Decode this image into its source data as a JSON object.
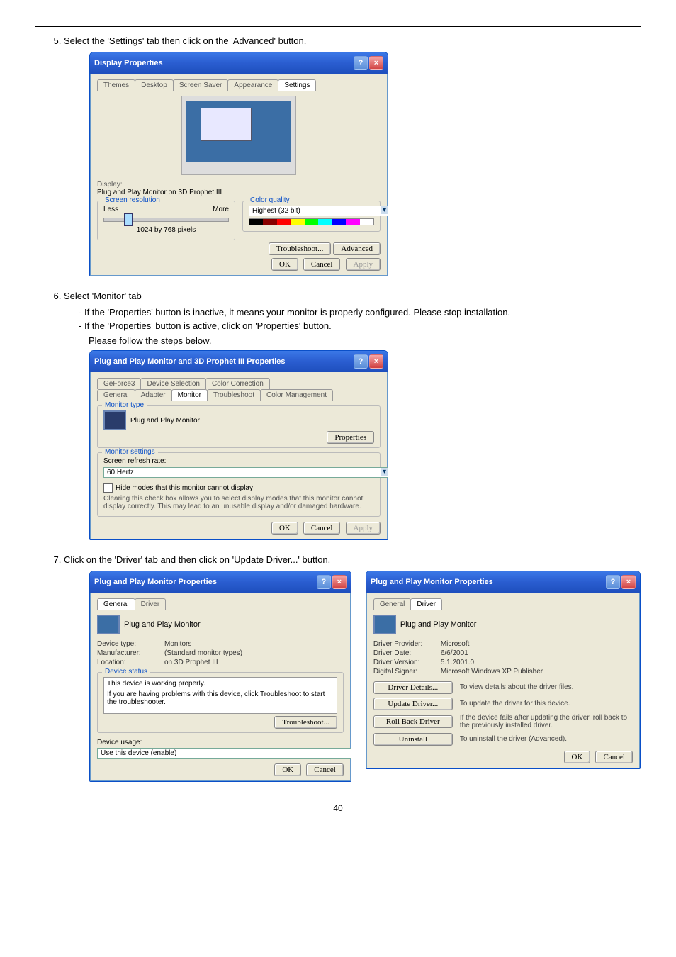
{
  "page_number": "40",
  "steps": {
    "s5": "Select the 'Settings' tab then click on the 'Advanced' button.",
    "s6": "Select 'Monitor' tab",
    "s6_a": "If the 'Properties' button is inactive, it means your monitor is properly configured. Please stop installation.",
    "s6_b": "If the 'Properties' button is active, click on 'Properties' button.",
    "s6_follow": "Please follow the steps below.",
    "s7": "Click on the 'Driver' tab and then click on 'Update Driver...' button."
  },
  "win1": {
    "title": "Display Properties",
    "tabs": [
      "Themes",
      "Desktop",
      "Screen Saver",
      "Appearance",
      "Settings"
    ],
    "display_label": "Display:",
    "display_value": "Plug and Play Monitor on 3D Prophet III",
    "screen_res_title": "Screen resolution",
    "less": "Less",
    "more": "More",
    "res_value": "1024 by 768 pixels",
    "color_title": "Color quality",
    "color_value": "Highest (32 bit)",
    "troubleshoot": "Troubleshoot...",
    "advanced": "Advanced",
    "ok": "OK",
    "cancel": "Cancel",
    "apply": "Apply"
  },
  "win2": {
    "title": "Plug and Play Monitor and 3D Prophet III Properties",
    "top_tabs": [
      "GeForce3",
      "Device Selection",
      "Color Correction"
    ],
    "bot_tabs": [
      "General",
      "Adapter",
      "Monitor",
      "Troubleshoot",
      "Color Management"
    ],
    "montype_title": "Monitor type",
    "montype_name": "Plug and Play Monitor",
    "properties": "Properties",
    "monset_title": "Monitor settings",
    "refresh_label": "Screen refresh rate:",
    "refresh_value": "60 Hertz",
    "hide_checkbox": "Hide modes that this monitor cannot display",
    "hide_explain": "Clearing this check box allows you to select display modes that this monitor cannot display correctly. This may lead to an unusable display and/or damaged hardware.",
    "ok": "OK",
    "cancel": "Cancel",
    "apply": "Apply"
  },
  "win3": {
    "title": "Plug and Play Monitor Properties",
    "tabs": [
      "General",
      "Driver"
    ],
    "name": "Plug and Play Monitor",
    "devtype_k": "Device type:",
    "devtype_v": "Monitors",
    "mfg_k": "Manufacturer:",
    "mfg_v": "(Standard monitor types)",
    "loc_k": "Location:",
    "loc_v": "on 3D Prophet III",
    "status_title": "Device status",
    "status_text": "This device is working properly.",
    "status_hint": "If you are having problems with this device, click Troubleshoot to start the troubleshooter.",
    "troubleshoot": "Troubleshoot...",
    "usage_label": "Device usage:",
    "usage_value": "Use this device (enable)",
    "ok": "OK",
    "cancel": "Cancel"
  },
  "win4": {
    "title": "Plug and Play Monitor Properties",
    "tabs": [
      "General",
      "Driver"
    ],
    "name": "Plug and Play Monitor",
    "prov_k": "Driver Provider:",
    "prov_v": "Microsoft",
    "date_k": "Driver Date:",
    "date_v": "6/6/2001",
    "ver_k": "Driver Version:",
    "ver_v": "5.1.2001.0",
    "sign_k": "Digital Signer:",
    "sign_v": "Microsoft Windows XP Publisher",
    "details_btn": "Driver Details...",
    "details_desc": "To view details about the driver files.",
    "update_btn": "Update Driver...",
    "update_desc": "To update the driver for this device.",
    "rollback_btn": "Roll Back Driver",
    "rollback_desc": "If the device fails after updating the driver, roll back to the previously installed driver.",
    "uninstall_btn": "Uninstall",
    "uninstall_desc": "To uninstall the driver (Advanced).",
    "ok": "OK",
    "cancel": "Cancel"
  }
}
